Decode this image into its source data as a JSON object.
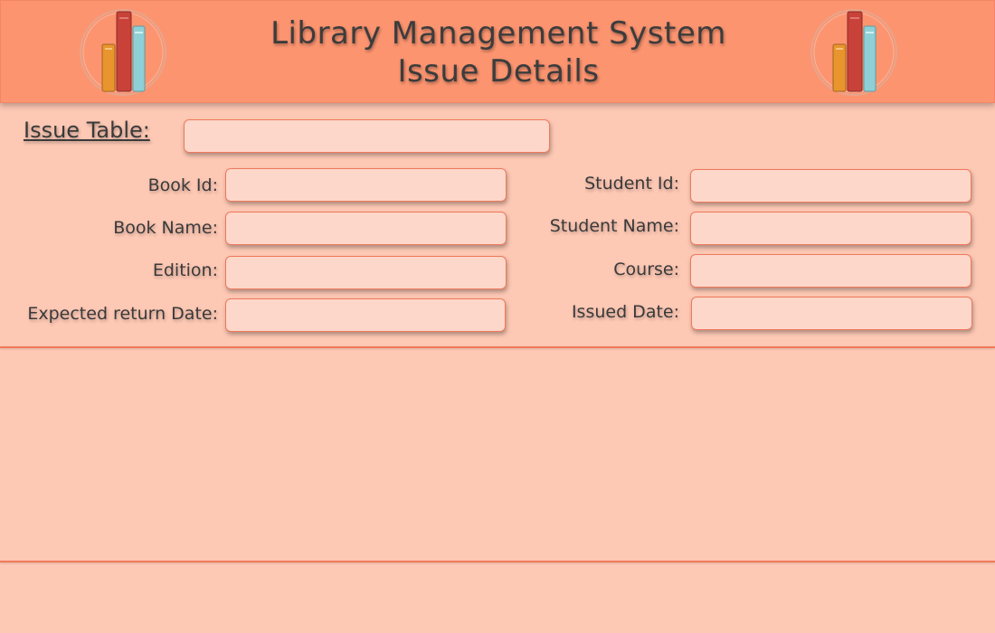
{
  "header": {
    "title_line1": "Library Management System",
    "title_line2": "Issue Details"
  },
  "form": {
    "section_label": "Issue Table:",
    "fields_left": [
      {
        "label": "Book Id:",
        "value": ""
      },
      {
        "label": "Book Name:",
        "value": ""
      },
      {
        "label": "Edition:",
        "value": ""
      },
      {
        "label": "Expected return Date:",
        "value": ""
      }
    ],
    "fields_right": [
      {
        "label": "Student Id:",
        "value": ""
      },
      {
        "label": "Student Name:",
        "value": ""
      },
      {
        "label": "Course:",
        "value": ""
      },
      {
        "label": "Issued Date:",
        "value": ""
      }
    ],
    "issue_table_value": ""
  },
  "colors": {
    "background": "#fdc8b4",
    "header": "#fc9470",
    "field_fill": "#fdd7ca",
    "field_border": "#ee7a5b",
    "book_orange": "#e8952e",
    "book_red": "#c8423a",
    "book_teal": "#8fd0d6"
  },
  "icons": {
    "logo": "books-icon"
  }
}
